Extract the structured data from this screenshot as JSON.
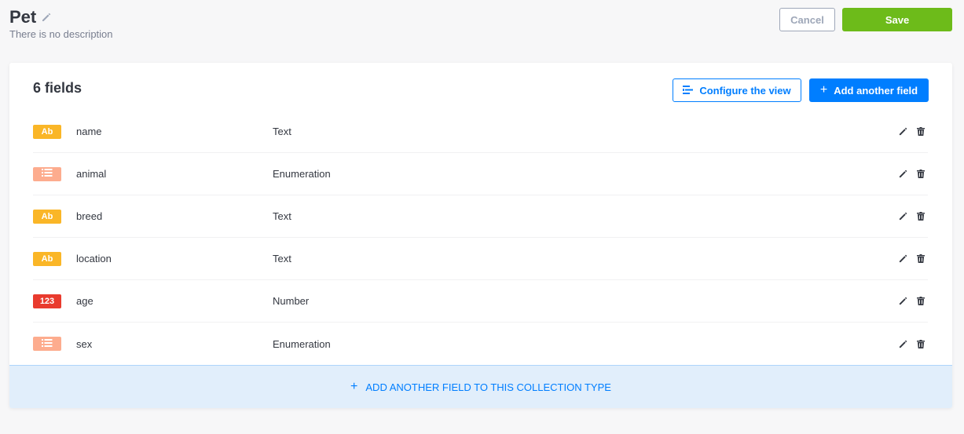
{
  "header": {
    "title": "Pet",
    "description": "There is no description",
    "cancel_label": "Cancel",
    "save_label": "Save"
  },
  "card": {
    "field_count_label": "6 fields",
    "configure_label": "Configure the view",
    "add_field_label": "Add another field",
    "fields": [
      {
        "badge": "Ab",
        "kind": "text",
        "name": "name",
        "type": "Text"
      },
      {
        "badge": "",
        "kind": "enum",
        "name": "animal",
        "type": "Enumeration"
      },
      {
        "badge": "Ab",
        "kind": "text",
        "name": "breed",
        "type": "Text"
      },
      {
        "badge": "Ab",
        "kind": "text",
        "name": "location",
        "type": "Text"
      },
      {
        "badge": "123",
        "kind": "number",
        "name": "age",
        "type": "Number"
      },
      {
        "badge": "",
        "kind": "enum",
        "name": "sex",
        "type": "Enumeration"
      }
    ],
    "footer_label": "ADD ANOTHER FIELD TO THIS COLLECTION TYPE"
  },
  "colors": {
    "primary": "#007eff",
    "success": "#6dbb1a",
    "text_badge": "#fab627",
    "enum_badge": "#fdac8e",
    "number_badge": "#e93b2e"
  },
  "icons": {
    "title_edit": "pencil-icon",
    "configure": "list-settings-icon",
    "row_edit": "pencil-icon",
    "row_delete": "trash-icon",
    "enum_badge": "list-icon"
  }
}
